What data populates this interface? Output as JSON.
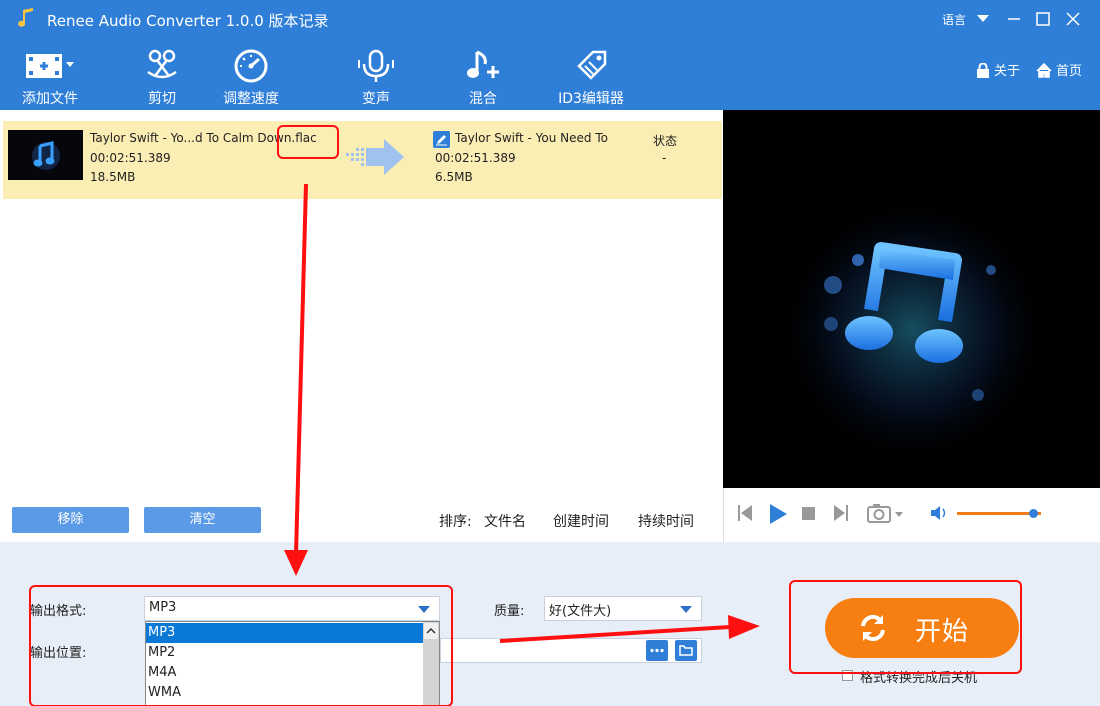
{
  "app": {
    "title": "Renee Audio Converter 1.0.0 版本记录",
    "language_label": "语言"
  },
  "toolbar": {
    "tools": [
      {
        "label": "添加文件"
      },
      {
        "label": "剪切"
      },
      {
        "label": "调整速度"
      },
      {
        "label": "变声"
      },
      {
        "label": "混合"
      },
      {
        "label": "ID3编辑器"
      }
    ],
    "about_label": "关于",
    "home_label": "首页"
  },
  "file_list": {
    "source": {
      "name": "Taylor Swift - Yo...d To Calm Down.flac",
      "duration": "00:02:51.389",
      "size": "18.5MB"
    },
    "output": {
      "name": "Taylor Swift - You Need To",
      "duration": "00:02:51.389",
      "size": "6.5MB"
    },
    "status_header": "状态",
    "status_value": "-",
    "remove_label": "移除",
    "clear_label": "清空",
    "sort_label": "排序:",
    "sort_options": [
      "文件名",
      "创建时间",
      "持续时间"
    ]
  },
  "player": {
    "volume_level": 0.9
  },
  "output": {
    "format_label": "输出格式:",
    "format_value": "MP3",
    "format_options": [
      "MP3",
      "MP2",
      "M4A",
      "WMA"
    ],
    "location_label": "输出位置:",
    "quality_label": "质量:",
    "quality_value": "好(文件大)",
    "start_label": "开始",
    "shutdown_label": "格式转换完成后关机"
  },
  "colors": {
    "accent": "#2f7fd9",
    "start": "#f77f12",
    "highlight_row": "#fbeeb4",
    "annotation": "#ff0000"
  }
}
